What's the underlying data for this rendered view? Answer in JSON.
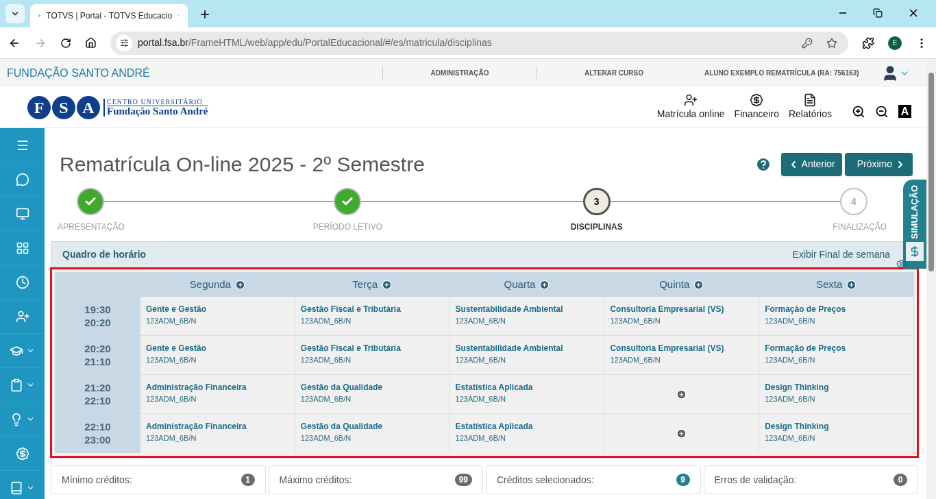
{
  "browser": {
    "tab_title": "TOTVS | Portal - TOTVS Educacio",
    "url_host": "portal.fsa.br",
    "url_path": "/FrameHTML/web/app/edu/PortalEducacional/#/es/matricula/disciplinas",
    "profile_initial": "E"
  },
  "topbar": {
    "brand": "FUNDAÇÃO SANTO ANDRÉ",
    "links": [
      "ADMINISTRAÇÃO",
      "ALTERAR CURSO"
    ],
    "user": "ALUNO EXEMPLO REMATRÍCULA (RA: 756163)"
  },
  "header": {
    "logo_letters": [
      "F",
      "S",
      "A"
    ],
    "logo_top": "CENTRO UNIVERSITÁRIO",
    "logo_bottom": "Fundação Santo André",
    "nav": [
      {
        "label": "Matrícula online",
        "kind": "enroll"
      },
      {
        "label": "Financeiro",
        "kind": "finance"
      },
      {
        "label": "Relatórios",
        "kind": "reports"
      }
    ],
    "contrast_label": "A"
  },
  "sidebar": {
    "items": [
      {
        "kind": "menu",
        "expandable": false
      },
      {
        "kind": "chat",
        "expandable": false
      },
      {
        "kind": "monitor",
        "expandable": false
      },
      {
        "kind": "grid",
        "expandable": false
      },
      {
        "kind": "clock",
        "expandable": false
      },
      {
        "kind": "enroll",
        "expandable": false
      },
      {
        "kind": "grad",
        "expandable": true
      },
      {
        "kind": "clipboard",
        "expandable": true
      },
      {
        "kind": "bulb",
        "expandable": true
      },
      {
        "kind": "finance",
        "expandable": false
      },
      {
        "kind": "book",
        "expandable": true
      }
    ]
  },
  "page": {
    "title": "Rematrícula On-line 2025 - 2º Semestre",
    "buttons": [
      {
        "label": "Anterior",
        "kind": "prev"
      },
      {
        "label": "Próximo",
        "kind": "next"
      }
    ]
  },
  "steps": [
    {
      "label": "APRESENTAÇÃO",
      "completed": true,
      "selected": false
    },
    {
      "label": "PERÍODO LETIVO",
      "completed": true,
      "selected": false
    },
    {
      "label": "DISCIPLINAS",
      "number": "3",
      "completed": false,
      "selected": true
    },
    {
      "label": "FINALIZAÇÃO",
      "number": "4",
      "completed": false,
      "selected": false
    }
  ],
  "simulation_tab": {
    "label": "SIMULAÇÃO"
  },
  "schedule": {
    "title": "Quadro de horário",
    "weekend_toggle": "Exibir Final de semana",
    "days": [
      "Segunda",
      "Terça",
      "Quarta",
      "Quinta",
      "Sexta"
    ],
    "rows": [
      {
        "start": "19:30",
        "end": "20:20",
        "cells": [
          {
            "kind": "class",
            "name": "Gente e Gestão",
            "code": "123ADM_6B/N"
          },
          {
            "kind": "class",
            "name": "Gestão Fiscal e Tributária",
            "code": "123ADM_6B/N"
          },
          {
            "kind": "class",
            "name": "Sustentabilidade Ambiental",
            "code": "123ADM_6B/N"
          },
          {
            "kind": "class",
            "name": "Consultoria Empresarial (VS)",
            "code": "123ADM_6B/N"
          },
          {
            "kind": "class",
            "name": "Formação de Preços",
            "code": "123ADM_6B/N"
          }
        ]
      },
      {
        "start": "20:20",
        "end": "21:10",
        "cells": [
          {
            "kind": "class",
            "name": "Gente e Gestão",
            "code": "123ADM_6B/N"
          },
          {
            "kind": "class",
            "name": "Gestão Fiscal e Tributária",
            "code": "123ADM_6B/N"
          },
          {
            "kind": "class",
            "name": "Sustentabilidade Ambiental",
            "code": "123ADM_6B/N"
          },
          {
            "kind": "class",
            "name": "Consultoria Empresarial (VS)",
            "code": "123ADM_6B/N"
          },
          {
            "kind": "class",
            "name": "Formação de Preços",
            "code": "123ADM_6B/N"
          }
        ]
      },
      {
        "start": "21:20",
        "end": "22:10",
        "cells": [
          {
            "kind": "class",
            "name": "Administração Financeira",
            "code": "123ADM_6B/N"
          },
          {
            "kind": "class",
            "name": "Gestão da Qualidade",
            "code": "123ADM_6B/N"
          },
          {
            "kind": "class",
            "name": "Estatística Aplicada",
            "code": "123ADM_6B/N"
          },
          {
            "kind": "empty"
          },
          {
            "kind": "class",
            "name": "Design Thinking",
            "code": "123ADM_6B/N"
          }
        ]
      },
      {
        "start": "22:10",
        "end": "23:00",
        "cells": [
          {
            "kind": "class",
            "name": "Administração Financeira",
            "code": "123ADM_6B/N"
          },
          {
            "kind": "class",
            "name": "Gestão da Qualidade",
            "code": "123ADM_6B/N"
          },
          {
            "kind": "class",
            "name": "Estatística Aplicada",
            "code": "123ADM_6B/N"
          },
          {
            "kind": "empty"
          },
          {
            "kind": "class",
            "name": "Design Thinking",
            "code": "123ADM_6B/N"
          }
        ]
      }
    ]
  },
  "counters": [
    {
      "label": "Mínimo créditos:",
      "value": "1",
      "color": "#6b6b6b"
    },
    {
      "label": "Máximo créditos:",
      "value": "99",
      "color": "#6b6b6b"
    },
    {
      "label": "Créditos selecionados:",
      "value": "9",
      "color": "#22808f"
    },
    {
      "label": "Erros de validação:",
      "value": "0",
      "color": "#6b6b6b"
    }
  ]
}
